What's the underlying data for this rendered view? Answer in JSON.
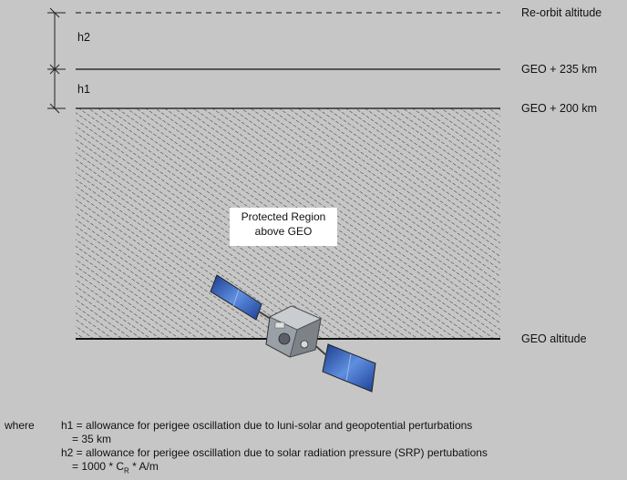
{
  "levels": {
    "reorbit": "Re-orbit altitude",
    "geo235": "GEO + 235 km",
    "geo200": "GEO +  200 km",
    "geo": "GEO altitude"
  },
  "dimensions": {
    "h2": "h2",
    "h1": "h1"
  },
  "region": {
    "line1": "Protected Region",
    "line2": "above GEO"
  },
  "legend": {
    "where": "where",
    "h1_def": "h1 = allowance for perigee oscillation due to luni-solar and geopotential perturbations",
    "h1_val": "= 35 km",
    "h2_def": "h2 = allowance for perigee oscillation due to solar radiation pressure (SRP) pertubations",
    "h2_val_prefix": "= 1000 * C",
    "h2_val_sub": "R",
    "h2_val_suffix": " * A/m"
  },
  "colors": {
    "background": "#c6c6c6",
    "hatch": "#222222",
    "panel": "#2f58b8",
    "bus": "#8a8f96"
  }
}
